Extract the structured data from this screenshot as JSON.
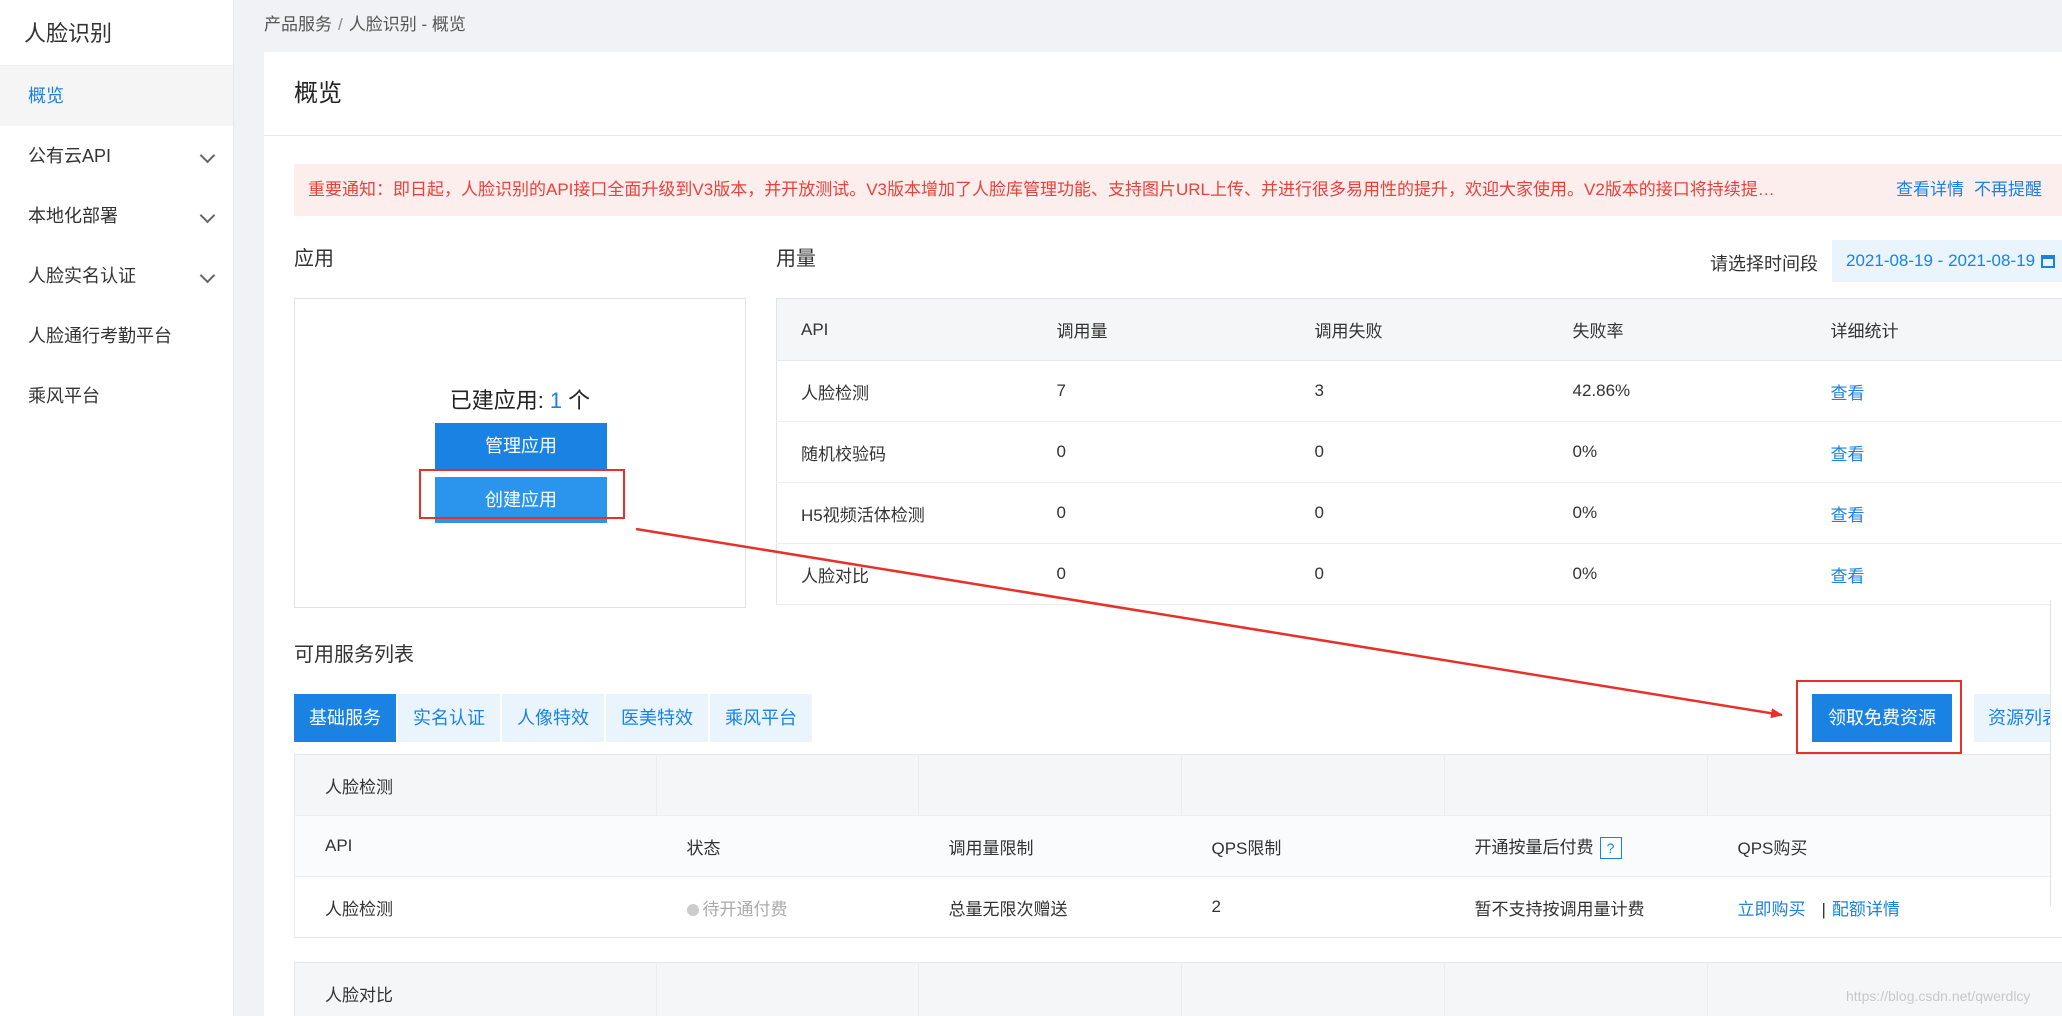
{
  "sidebar": {
    "title": "人脸识别",
    "items": [
      {
        "label": "概览",
        "active": true,
        "expandable": false
      },
      {
        "label": "公有云API",
        "expandable": true
      },
      {
        "label": "本地化部署",
        "expandable": true
      },
      {
        "label": "人脸实名认证",
        "expandable": true
      },
      {
        "label": "人脸通行考勤平台",
        "expandable": false
      },
      {
        "label": "乘风平台",
        "expandable": false
      }
    ]
  },
  "breadcrumb": {
    "root": "产品服务",
    "separator": "/",
    "current": "人脸识别 - 概览"
  },
  "page_title": "概览",
  "notice": {
    "text": "重要通知：即日起，人脸识别的API接口全面升级到V3版本，并开放测试。V3版本增加了人脸库管理功能、支持图片URL上传、并进行很多易用性的提升，欢迎大家使用。V2版本的接口将持续提…",
    "link_details": "查看详情",
    "link_dismiss": "不再提醒"
  },
  "apps": {
    "section_label": "应用",
    "count_label": "已建应用:",
    "count": "1",
    "count_unit": "个",
    "manage_button": "管理应用",
    "create_button": "创建应用"
  },
  "usage": {
    "section_label": "用量",
    "date_label": "请选择时间段",
    "date_range": "2021-08-19 - 2021-08-19",
    "columns": [
      "API",
      "调用量",
      "调用失败",
      "失败率",
      "详细统计"
    ],
    "rows": [
      {
        "api": "人脸检测",
        "calls": "7",
        "failed": "3",
        "rate": "42.86%",
        "link": "查看"
      },
      {
        "api": "随机校验码",
        "calls": "0",
        "failed": "0",
        "rate": "0%",
        "link": "查看"
      },
      {
        "api": "H5视频活体检测",
        "calls": "0",
        "failed": "0",
        "rate": "0%",
        "link": "查看"
      },
      {
        "api": "人脸对比",
        "calls": "0",
        "failed": "0",
        "rate": "0%",
        "link": "查看"
      }
    ]
  },
  "services": {
    "section_label": "可用服务列表",
    "tabs": [
      "基础服务",
      "实名认证",
      "人像特效",
      "医美特效",
      "乘风平台"
    ],
    "active_tab": 0,
    "free_button": "领取免费资源",
    "list_button": "资源列表",
    "group1": {
      "title": "人脸检测",
      "columns": [
        "API",
        "状态",
        "调用量限制",
        "QPS限制",
        "开通按量后付费",
        "QPS购买"
      ],
      "help_icon": "?",
      "row": {
        "api": "人脸检测",
        "status": "待开通付费",
        "limit": "总量无限次赠送",
        "qps": "2",
        "postpaid": "暂不支持按调用量计费",
        "buy_link": "立即购买",
        "quota_link": "配额详情"
      }
    },
    "group2": {
      "title": "人脸对比"
    }
  },
  "watermark": "https://blog.csdn.net/qwerdlcy",
  "colors": {
    "accent": "#1a82e2",
    "notice_text": "#e8413a",
    "annotation": "#e8302b"
  }
}
